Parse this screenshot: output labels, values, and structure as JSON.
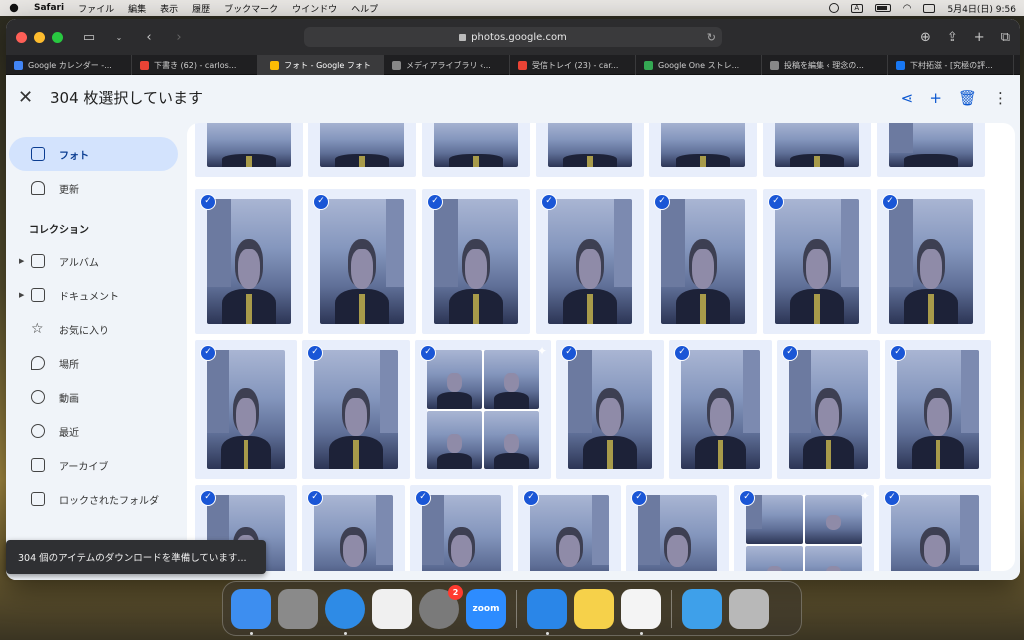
{
  "menubar": {
    "app": "Safari",
    "items": [
      "ファイル",
      "編集",
      "表示",
      "履歴",
      "ブックマーク",
      "ウインドウ",
      "ヘルプ"
    ],
    "input_indicator": "A",
    "datetime": "5月4日(日)  9:56"
  },
  "browser": {
    "url": "photos.google.com",
    "tabs": [
      {
        "label": "Google カレンダー -...",
        "favicon_color": "#4285f4",
        "active": false
      },
      {
        "label": "下書き (62) - carlos...",
        "favicon_color": "#ea4335",
        "active": false
      },
      {
        "label": "フォト - Google フォト",
        "favicon_color": "#fbbc04",
        "active": true
      },
      {
        "label": "メディアライブラリ ‹...",
        "favicon_color": "#888888",
        "active": false
      },
      {
        "label": "受信トレイ (23) - car...",
        "favicon_color": "#ea4335",
        "active": false
      },
      {
        "label": "Google One ストレ...",
        "favicon_color": "#34a853",
        "active": false
      },
      {
        "label": "投稿を編集 ‹ 理念の...",
        "favicon_color": "#888888",
        "active": false
      },
      {
        "label": "下村拓滋 - [究極の評...",
        "favicon_color": "#1877f2",
        "active": false
      }
    ]
  },
  "selection": {
    "title": "304 枚選択しています"
  },
  "sidebar": {
    "items": [
      {
        "label": "フォト",
        "icon": "photo-icon",
        "active": true
      },
      {
        "label": "更新",
        "icon": "bell-icon"
      }
    ],
    "section_title": "コレクション",
    "collection_items": [
      {
        "label": "アルバム",
        "icon": "album-icon",
        "expandable": true
      },
      {
        "label": "ドキュメント",
        "icon": "document-icon",
        "expandable": true
      },
      {
        "label": "お気に入り",
        "icon": "star-icon"
      },
      {
        "label": "場所",
        "icon": "location-icon"
      },
      {
        "label": "動画",
        "icon": "play-icon"
      },
      {
        "label": "最近",
        "icon": "clock-icon"
      },
      {
        "label": "アーカイブ",
        "icon": "archive-icon"
      },
      {
        "label": "ロックされたフォルダ",
        "icon": "lock-icon"
      }
    ]
  },
  "toast": {
    "message": "304 個のアイテムのダウンロードを準備しています..."
  },
  "dock": {
    "apps": [
      {
        "name": "finder",
        "color": "#3d8ef0",
        "running": true
      },
      {
        "name": "launchpad",
        "color": "#8a8a8a",
        "running": false
      },
      {
        "name": "safari",
        "color": "#2e8be6",
        "running": true
      },
      {
        "name": "freeform",
        "color": "#f0f0f0",
        "running": false
      },
      {
        "name": "system-settings",
        "color": "#7a7a7a",
        "running": false,
        "badge": "2"
      },
      {
        "name": "zoom",
        "color": "#2d8cff",
        "running": false,
        "label": "zoom"
      },
      {
        "name": "keynote",
        "color": "#2a86e8",
        "running": true
      },
      {
        "name": "notes",
        "color": "#f6d14a",
        "running": false
      },
      {
        "name": "textedit",
        "color": "#f4f4f4",
        "running": true
      },
      {
        "name": "folder",
        "color": "#3ea0ea",
        "running": false
      },
      {
        "name": "trash",
        "color": "#b8b8b8",
        "running": false
      }
    ]
  }
}
